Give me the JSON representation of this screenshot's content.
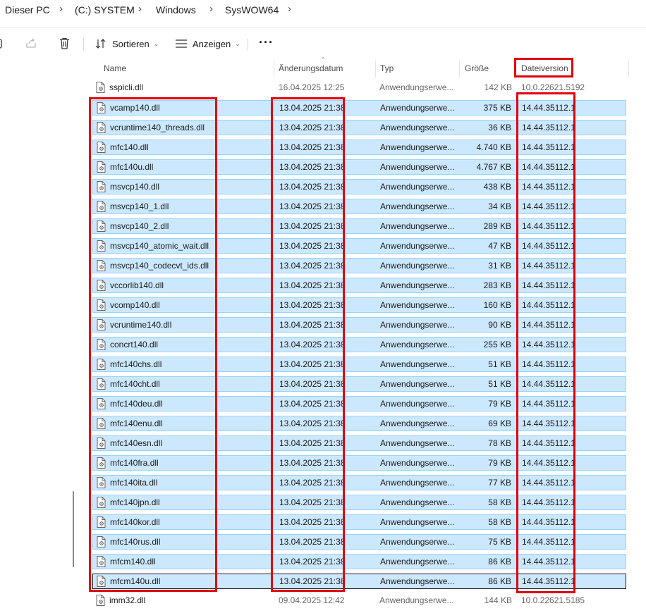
{
  "breadcrumb": {
    "items": [
      "Dieser PC",
      "(C:) SYSTEM",
      "Windows",
      "SysWOW64"
    ]
  },
  "toolbar": {
    "sort_label": "Sortieren",
    "view_label": "Anzeigen",
    "more_label": "···"
  },
  "columns": {
    "name": "Name",
    "date": "Änderungsdatum",
    "type": "Typ",
    "size": "Größe",
    "version": "Dateiversion"
  },
  "files": [
    {
      "name": "sspicli.dll",
      "date": "16.04.2025 12:25",
      "type": "Anwendungserwe...",
      "size": "142 KB",
      "version": "10.0.22621.5192",
      "selected": false
    },
    {
      "name": "vcamp140.dll",
      "date": "13.04.2025 21:38",
      "type": "Anwendungserwe...",
      "size": "375 KB",
      "version": "14.44.35112.1",
      "selected": true
    },
    {
      "name": "vcruntime140_threads.dll",
      "date": "13.04.2025 21:38",
      "type": "Anwendungserwe...",
      "size": "36 KB",
      "version": "14.44.35112.1",
      "selected": true
    },
    {
      "name": "mfc140.dll",
      "date": "13.04.2025 21:38",
      "type": "Anwendungserwe...",
      "size": "4.740 KB",
      "version": "14.44.35112.1",
      "selected": true
    },
    {
      "name": "mfc140u.dll",
      "date": "13.04.2025 21:38",
      "type": "Anwendungserwe...",
      "size": "4.767 KB",
      "version": "14.44.35112.1",
      "selected": true
    },
    {
      "name": "msvcp140.dll",
      "date": "13.04.2025 21:38",
      "type": "Anwendungserwe...",
      "size": "438 KB",
      "version": "14.44.35112.1",
      "selected": true
    },
    {
      "name": "msvcp140_1.dll",
      "date": "13.04.2025 21:38",
      "type": "Anwendungserwe...",
      "size": "34 KB",
      "version": "14.44.35112.1",
      "selected": true
    },
    {
      "name": "msvcp140_2.dll",
      "date": "13.04.2025 21:38",
      "type": "Anwendungserwe...",
      "size": "289 KB",
      "version": "14.44.35112.1",
      "selected": true
    },
    {
      "name": "msvcp140_atomic_wait.dll",
      "date": "13.04.2025 21:38",
      "type": "Anwendungserwe...",
      "size": "47 KB",
      "version": "14.44.35112.1",
      "selected": true
    },
    {
      "name": "msvcp140_codecvt_ids.dll",
      "date": "13.04.2025 21:38",
      "type": "Anwendungserwe...",
      "size": "31 KB",
      "version": "14.44.35112.1",
      "selected": true
    },
    {
      "name": "vccorlib140.dll",
      "date": "13.04.2025 21:38",
      "type": "Anwendungserwe...",
      "size": "283 KB",
      "version": "14.44.35112.1",
      "selected": true
    },
    {
      "name": "vcomp140.dll",
      "date": "13.04.2025 21:38",
      "type": "Anwendungserwe...",
      "size": "160 KB",
      "version": "14.44.35112.1",
      "selected": true
    },
    {
      "name": "vcruntime140.dll",
      "date": "13.04.2025 21:38",
      "type": "Anwendungserwe...",
      "size": "90 KB",
      "version": "14.44.35112.1",
      "selected": true
    },
    {
      "name": "concrt140.dll",
      "date": "13.04.2025 21:38",
      "type": "Anwendungserwe...",
      "size": "255 KB",
      "version": "14.44.35112.1",
      "selected": true
    },
    {
      "name": "mfc140chs.dll",
      "date": "13.04.2025 21:38",
      "type": "Anwendungserwe...",
      "size": "51 KB",
      "version": "14.44.35112.1",
      "selected": true
    },
    {
      "name": "mfc140cht.dll",
      "date": "13.04.2025 21:38",
      "type": "Anwendungserwe...",
      "size": "51 KB",
      "version": "14.44.35112.1",
      "selected": true
    },
    {
      "name": "mfc140deu.dll",
      "date": "13.04.2025 21:38",
      "type": "Anwendungserwe...",
      "size": "79 KB",
      "version": "14.44.35112.1",
      "selected": true
    },
    {
      "name": "mfc140enu.dll",
      "date": "13.04.2025 21:38",
      "type": "Anwendungserwe...",
      "size": "69 KB",
      "version": "14.44.35112.1",
      "selected": true
    },
    {
      "name": "mfc140esn.dll",
      "date": "13.04.2025 21:38",
      "type": "Anwendungserwe...",
      "size": "78 KB",
      "version": "14.44.35112.1",
      "selected": true
    },
    {
      "name": "mfc140fra.dll",
      "date": "13.04.2025 21:38",
      "type": "Anwendungserwe...",
      "size": "79 KB",
      "version": "14.44.35112.1",
      "selected": true
    },
    {
      "name": "mfc140ita.dll",
      "date": "13.04.2025 21:38",
      "type": "Anwendungserwe...",
      "size": "77 KB",
      "version": "14.44.35112.1",
      "selected": true
    },
    {
      "name": "mfc140jpn.dll",
      "date": "13.04.2025 21:38",
      "type": "Anwendungserwe...",
      "size": "58 KB",
      "version": "14.44.35112.1",
      "selected": true
    },
    {
      "name": "mfc140kor.dll",
      "date": "13.04.2025 21:38",
      "type": "Anwendungserwe...",
      "size": "58 KB",
      "version": "14.44.35112.1",
      "selected": true
    },
    {
      "name": "mfc140rus.dll",
      "date": "13.04.2025 21:38",
      "type": "Anwendungserwe...",
      "size": "75 KB",
      "version": "14.44.35112.1",
      "selected": true
    },
    {
      "name": "mfcm140.dll",
      "date": "13.04.2025 21:38",
      "type": "Anwendungserwe...",
      "size": "86 KB",
      "version": "14.44.35112.1",
      "selected": true
    },
    {
      "name": "mfcm140u.dll",
      "date": "13.04.2025 21:38",
      "type": "Anwendungserwe...",
      "size": "86 KB",
      "version": "14.44.35112.1",
      "selected": true,
      "focused": true
    },
    {
      "name": "imm32.dll",
      "date": "09.04.2025 12:42",
      "type": "Anwendungserwe...",
      "size": "144 KB",
      "version": "10.0.22621.5185",
      "selected": false
    }
  ],
  "colors": {
    "selection_fill": "#cce8ff",
    "selection_border": "#99d1ff",
    "highlight_red": "#e0000c"
  }
}
